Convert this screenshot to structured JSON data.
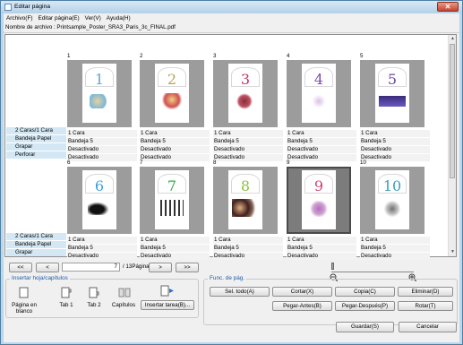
{
  "window": {
    "title": "Editar página",
    "close_glyph": "✕"
  },
  "menu": [
    {
      "label": "Archivo(F)"
    },
    {
      "label": "Editar página(E)"
    },
    {
      "label": "Ver(V)"
    },
    {
      "label": "Ayuda(H)"
    }
  ],
  "file": {
    "label": "Nombre de archivo : Printsample_Poster_SRA3_Paris_3c_FINAL.pdf"
  },
  "attribute_labels": [
    "2 Caras/1 Cara",
    "Bandeja Papel",
    "Grapar",
    "Perforar"
  ],
  "attribute_labels_row2": [
    "2 Caras/1 Cara",
    "Bandeja Papel",
    "Grapar"
  ],
  "pages": [
    {
      "num": "1",
      "color": "#5aa8d8",
      "sides": "1 Cara",
      "tray": "Bandeja 5",
      "staple": "Desactivado",
      "punch": "Desactivado"
    },
    {
      "num": "2",
      "color": "#b8a25a",
      "sides": "1 Cara",
      "tray": "Bandeja 5",
      "staple": "Desactivado",
      "punch": "Desactivado"
    },
    {
      "num": "3",
      "color": "#c0306a",
      "sides": "1 Cara",
      "tray": "Bandeja 5",
      "staple": "Desactivado",
      "punch": "Desactivado"
    },
    {
      "num": "4",
      "color": "#7a4fa8",
      "sides": "1 Cara",
      "tray": "Bandeja 5",
      "staple": "Desactivado",
      "punch": "Desactivado"
    },
    {
      "num": "5",
      "color": "#6a4aa0",
      "sides": "1 Cara",
      "tray": "Bandeja 5",
      "staple": "Desactivado",
      "punch": "Desactivado"
    },
    {
      "num": "6",
      "color": "#3aa0d8",
      "sides": "1 Cara",
      "tray": "Bandeja 5",
      "staple": "Desactivado"
    },
    {
      "num": "7",
      "color": "#3aa848",
      "sides": "1 Cara",
      "tray": "Bandeja 5",
      "staple": "Desactivado"
    },
    {
      "num": "8",
      "color": "#8ac040",
      "sides": "1 Cara",
      "tray": "Bandeja 5",
      "staple": "Desactivado"
    },
    {
      "num": "9",
      "color": "#d04070",
      "sides": "1 Cara",
      "tray": "Bandeja 5",
      "staple": "Desactivado"
    },
    {
      "num": "10",
      "color": "#3aa0b8",
      "sides": "1 Cara",
      "tray": "Bandeja 5",
      "staple": "Desactivado"
    }
  ],
  "page_labels": [
    "1",
    "2",
    "3",
    "4",
    "5",
    "6",
    "7",
    "8",
    "9",
    "10"
  ],
  "nav": {
    "first": "<<",
    "prev": "<",
    "next": ">",
    "last": ">>",
    "current_page": "7",
    "total": "/ 13Página"
  },
  "insert_group": {
    "title": "Insertar hoja/capítulos",
    "tools": [
      "Página en blanco",
      "Tab 1",
      "Tab 2",
      "Capítulos"
    ],
    "insert_task": "Insertar tarea(B)..."
  },
  "func_group": {
    "title": "Func. de pág.",
    "buttons": [
      "Sel. todo(A)",
      "Cortar(X)",
      "Copia(C)",
      "Eliminar(D)",
      "Pegar-Antes(B)",
      "Pegar-Después(P)",
      "Rotar(T)"
    ]
  },
  "footer": {
    "save": "Guardar(S)",
    "cancel": "Cancelar"
  },
  "colors": {
    "label_bg": "#d3e8f4",
    "group_title": "#1e5ba8"
  }
}
